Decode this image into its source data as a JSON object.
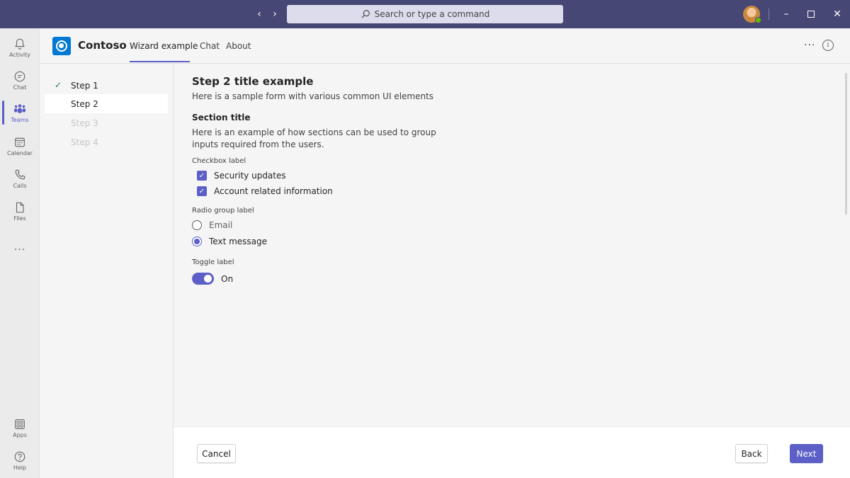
{
  "search": {
    "placeholder": "Search or type a command"
  },
  "rail": {
    "items": [
      {
        "label": "Activity",
        "icon": "bell-icon"
      },
      {
        "label": "Chat",
        "icon": "chat-icon"
      },
      {
        "label": "Teams",
        "icon": "teams-icon",
        "active": true
      },
      {
        "label": "Calendar",
        "icon": "calendar-icon"
      },
      {
        "label": "Calls",
        "icon": "phone-icon"
      },
      {
        "label": "Files",
        "icon": "file-icon"
      },
      {
        "label": "Apps",
        "icon": "apps-icon"
      },
      {
        "label": "Help",
        "icon": "help-icon"
      }
    ],
    "more": "..."
  },
  "header": {
    "app_name": "Contoso",
    "tabs": [
      {
        "label": "Wizard example",
        "active": true
      },
      {
        "label": "Chat"
      },
      {
        "label": "About"
      }
    ],
    "more": "···",
    "info": "i"
  },
  "steps": [
    {
      "label": "Step 1",
      "state": "completed"
    },
    {
      "label": "Step 2",
      "state": "current"
    },
    {
      "label": "Step 3",
      "state": "disabled"
    },
    {
      "label": "Step 4",
      "state": "disabled"
    }
  ],
  "form": {
    "title": "Step 2 title example",
    "subtitle": "Here is a sample form with various common UI elements",
    "section_title": "Section title",
    "section_desc": "Here is an example of how sections can be used to group inputs required from the users.",
    "checkbox_label": "Checkbox label",
    "checkboxes": [
      {
        "label": "Security updates",
        "checked": true
      },
      {
        "label": "Account related information",
        "checked": true
      }
    ],
    "radio_label": "Radio group label",
    "radios": [
      {
        "label": "Email",
        "selected": false
      },
      {
        "label": "Text message",
        "selected": true
      }
    ],
    "toggle_label": "Toggle label",
    "toggle_value": "On"
  },
  "footer": {
    "cancel": "Cancel",
    "back": "Back",
    "next": "Next"
  },
  "colors": {
    "titlebar": "#464775",
    "accent": "#5b5fc7",
    "brand_logo": "#0078d4"
  }
}
